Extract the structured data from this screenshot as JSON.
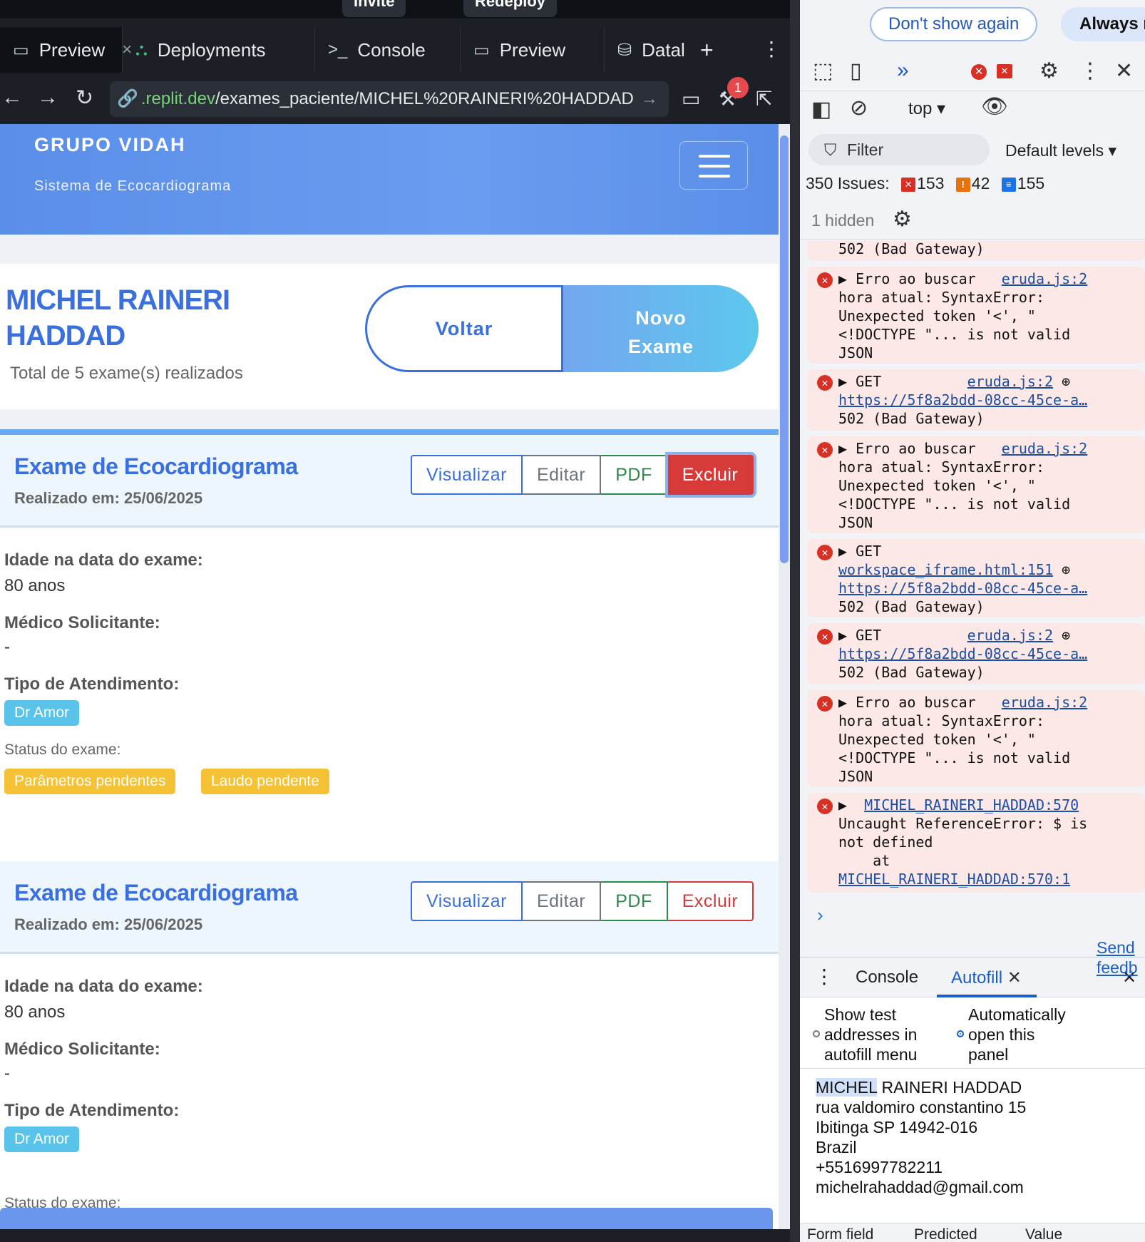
{
  "window": {
    "top_buttons": [
      "Invite",
      "Redeploy"
    ]
  },
  "tabs": [
    {
      "label": "Preview",
      "icon": "monitor-icon",
      "active": true
    },
    {
      "label": "Deployments",
      "icon": "deploy-icon"
    },
    {
      "label": "Console",
      "icon": "terminal-icon"
    },
    {
      "label": "Preview",
      "icon": "monitor-icon"
    },
    {
      "label": "Datal",
      "icon": "database-icon"
    }
  ],
  "url": {
    "domain": ".replit.dev",
    "path": "/exames_paciente/MICHEL%20RAINERI%20HADDAD",
    "badge": "1"
  },
  "app": {
    "brand": "GRUPO VIDAH",
    "subtitle": "Sistema de Ecocardiograma",
    "patient_name": "MICHEL RAINERI HADDAD",
    "total": "Total de 5 exame(s) realizados",
    "btn_back": "Voltar",
    "btn_new": "Novo Exame",
    "exams": [
      {
        "title": "Exame de Ecocardiograma",
        "date": "Realizado em: 25/06/2025",
        "actions": [
          "Visualizar",
          "Editar",
          "PDF",
          "Excluir"
        ],
        "age_label": "Idade na data do exame:",
        "age": "80 anos",
        "doctor_label": "Médico Solicitante:",
        "doctor": "-",
        "type_label": "Tipo de Atendimento:",
        "type": "Dr Amor",
        "status_label": "Status do exame:",
        "status": [
          "Parâmetros pendentes",
          "Laudo pendente"
        ]
      },
      {
        "title": "Exame de Ecocardiograma",
        "date": "Realizado em: 25/06/2025",
        "actions": [
          "Visualizar",
          "Editar",
          "PDF",
          "Excluir"
        ],
        "age_label": "Idade na data do exame:",
        "age": "80 anos",
        "doctor_label": "Médico Solicitante:",
        "doctor": "-",
        "type_label": "Tipo de Atendimento:",
        "type": "Dr Amor",
        "status_label": "Status do exame:"
      }
    ]
  },
  "devtools": {
    "dont_show": "Don't show again",
    "always": "Always r",
    "context": "top",
    "filter": "Filter",
    "levels": "Default levels",
    "issues_label": "350 Issues:",
    "issues_errors": "153",
    "issues_warnings": "42",
    "issues_info": "155",
    "hidden": "1 hidden",
    "logs": [
      {
        "lines": [
          "502 (Bad Gateway)"
        ],
        "partial": true
      },
      {
        "lines": [
          "▶ Erro ao buscar   ",
          "hora atual: SyntaxError:",
          "Unexpected token '<', \"",
          "<!DOCTYPE \"... is not valid",
          "JSON"
        ],
        "src": "eruda.js:2"
      },
      {
        "lines": [
          "▶ GET          ",
          "https://5f8a2bdd-08cc-45ce-a…",
          "502 (Bad Gateway)"
        ],
        "src": "eruda.js:2"
      },
      {
        "lines": [
          "▶ Erro ao buscar   ",
          "hora atual: SyntaxError:",
          "Unexpected token '<', \"",
          "<!DOCTYPE \"... is not valid",
          "JSON"
        ],
        "src": "eruda.js:2"
      },
      {
        "lines": [
          "▶ GET",
          "workspace_iframe.html:151",
          "https://5f8a2bdd-08cc-45ce-a…",
          "502 (Bad Gateway)"
        ]
      },
      {
        "lines": [
          "▶ GET          ",
          "https://5f8a2bdd-08cc-45ce-a…",
          "502 (Bad Gateway)"
        ],
        "src": "eruda.js:2"
      },
      {
        "lines": [
          "▶ Erro ao buscar   ",
          "hora atual: SyntaxError:",
          "Unexpected token '<', \"",
          "<!DOCTYPE \"... is not valid",
          "JSON"
        ],
        "src": "eruda.js:2"
      },
      {
        "lines": [
          "▶  ",
          "Uncaught ReferenceError: $ is",
          "not defined",
          "    at",
          "MICHEL_RAINERI_HADDAD:570:1"
        ],
        "src": "MICHEL_RAINERI_HADDAD:570"
      }
    ],
    "drawer_tabs": [
      "Console",
      "Autofill"
    ],
    "opt1": [
      "Show test",
      "addresses in",
      "autofill menu"
    ],
    "opt2": [
      "Automatically",
      "open this",
      "panel"
    ],
    "send": [
      "Send",
      "feedb"
    ],
    "address": [
      "MICHEL",
      "RAINERI HADDAD",
      "rua valdomiro constantino 15",
      "Ibitinga SP 14942-016",
      "Brazil",
      "+5516997782211",
      "michelrahaddad@gmail.com"
    ],
    "columns": [
      "Form field",
      "Predicted",
      "Value"
    ]
  }
}
